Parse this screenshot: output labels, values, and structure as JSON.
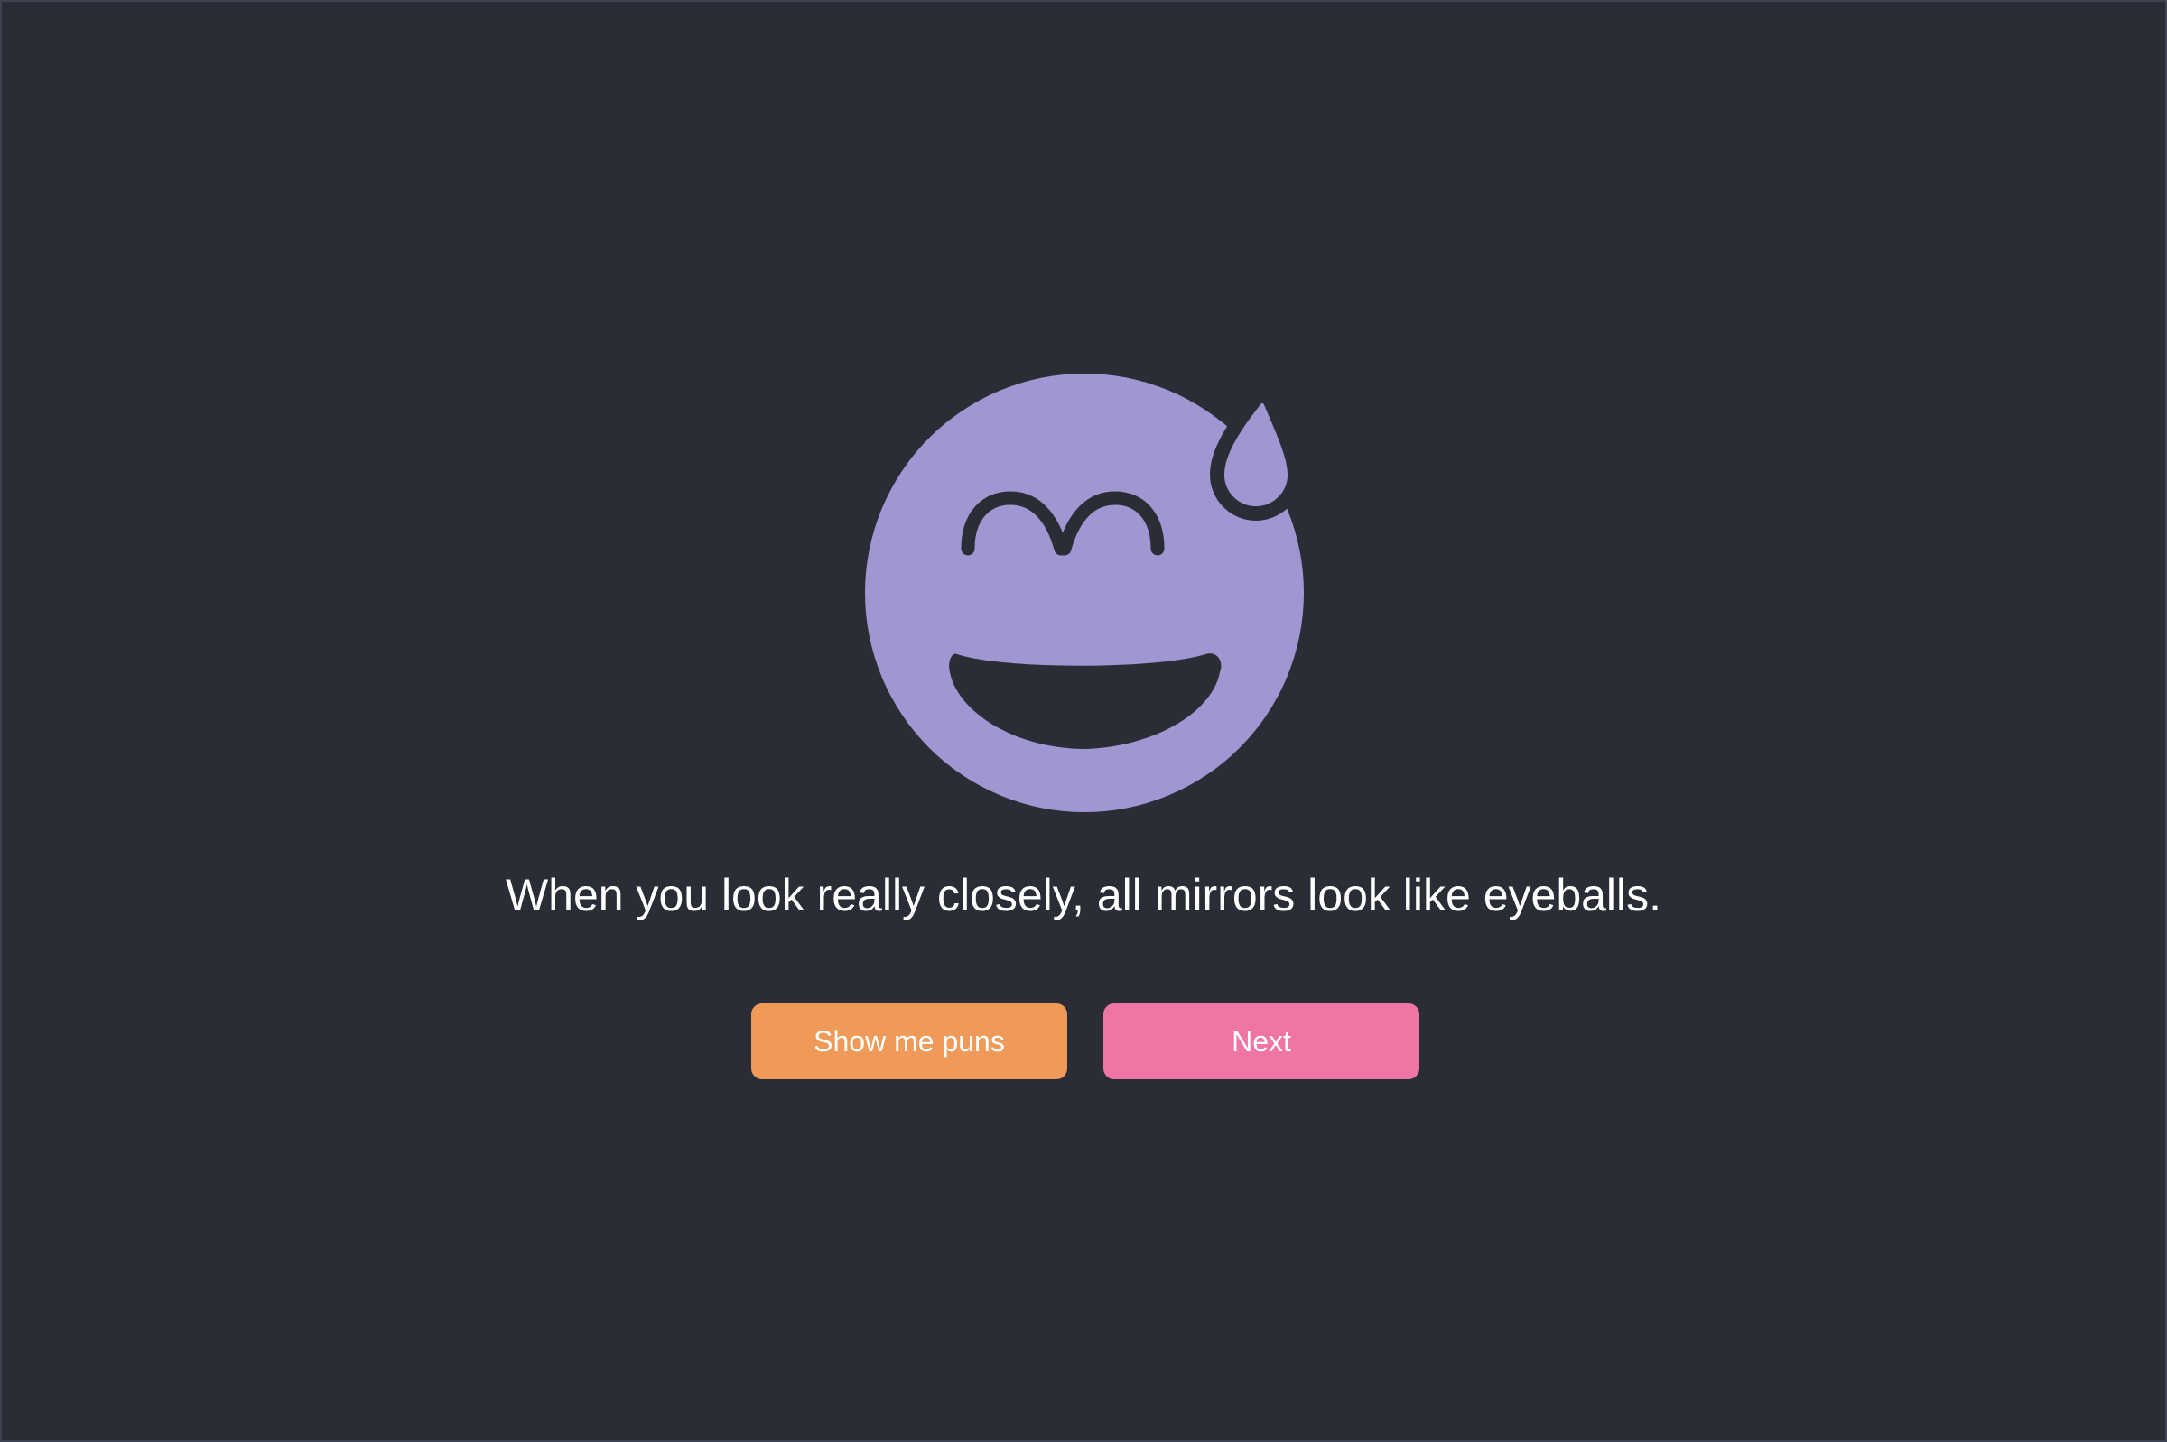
{
  "page": {
    "background_color": "#2a2d36"
  },
  "emoji": {
    "icon": "grinning-face-with-sweat-icon",
    "color": "#a096d2"
  },
  "joke": {
    "text": "When you look really closely, all mirrors look like eyeballs."
  },
  "actions": {
    "show_puns_label": "Show me puns",
    "show_puns_color": "#f09a59",
    "next_label": "Next",
    "next_color": "#ef75a5"
  }
}
